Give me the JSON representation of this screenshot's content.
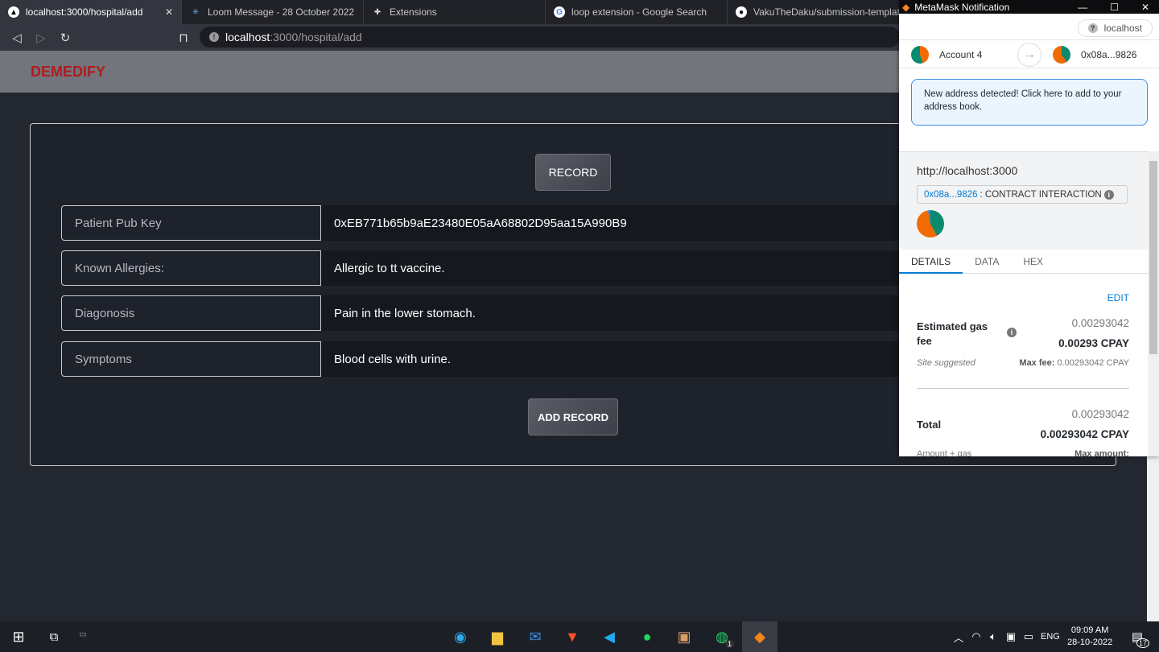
{
  "browser": {
    "tabs": [
      {
        "label": "localhost:3000/hospital/add",
        "icon": "triangle-icon"
      },
      {
        "label": "Loom Message - 28 October 2022",
        "icon": "loom-icon"
      },
      {
        "label": "Extensions",
        "icon": "puzzle-icon"
      },
      {
        "label": "loop extension - Google Search",
        "icon": "google-icon"
      },
      {
        "label": "VakuTheDaku/submission-template: I",
        "icon": "github-icon"
      }
    ],
    "url_host": "localhost",
    "url_path": ":3000/hospital/add"
  },
  "app": {
    "brand": "DEMEDIFY",
    "record_button": "RECORD",
    "add_record_button": "ADD RECORD",
    "fields": [
      {
        "label": "Patient Pub Key",
        "value": "0xEB771b65b9aE23480E05aA68802D95aa15A990B9"
      },
      {
        "label": "Known Allergies:",
        "value": "Allergic to tt vaccine."
      },
      {
        "label": "Diagonosis",
        "value": "Pain in the lower stomach."
      },
      {
        "label": "Symptoms",
        "value": "Blood cells with urine."
      }
    ],
    "brand_color": "#b01c1c"
  },
  "metamask": {
    "title": "MetaMask Notification",
    "site": "localhost",
    "from_account": "Account 4",
    "to_address": "0x08a...9826",
    "notice": "New address detected! Click here to add to your address book.",
    "origin": "http://localhost:3000",
    "contract_address": "0x08a...9826",
    "contract_label": ": CONTRACT INTERACTION",
    "tabs": [
      "DETAILS",
      "DATA",
      "HEX"
    ],
    "edit": "EDIT",
    "gas_label": "Estimated gas fee",
    "gas_value": "0.00293042",
    "gas_bold": "0.00293 CPAY",
    "site_suggested": "Site suggested",
    "max_fee_label": "Max fee:",
    "max_fee_value": "0.00293042 CPAY",
    "total_label": "Total",
    "total_value": "0.00293042",
    "total_bold": "0.00293042 CPAY",
    "amount_gas": "Amount + gas",
    "max_amount": "Max amount:"
  },
  "taskbar": {
    "time": "09:09 AM",
    "date": "28-10-2022",
    "lang": "ENG",
    "notifications": "17",
    "whatsapp_badge": "1"
  }
}
